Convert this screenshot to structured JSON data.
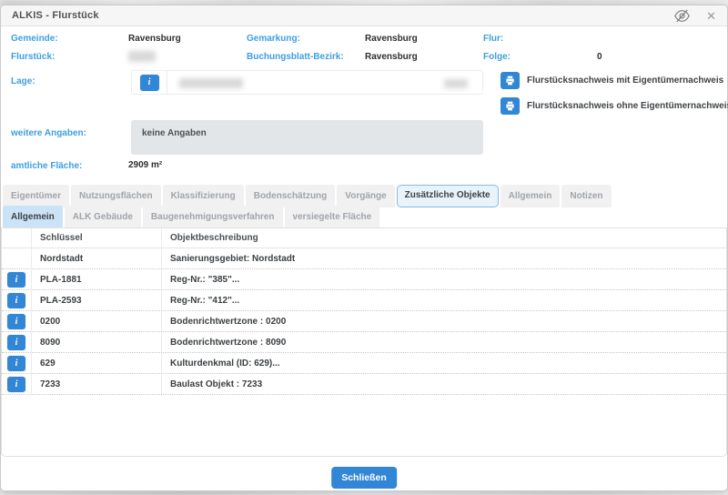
{
  "window": {
    "title": "ALKIS - Flurstück"
  },
  "icons": {
    "hide": "eye-slash",
    "close": "✕",
    "info": "i",
    "printer": "printer-glyph"
  },
  "colors": {
    "accent": "#3286d6",
    "label_blue": "#3d9fe0",
    "tab_active_main_bg": "#e9f3fb",
    "tab_active_sub_bg": "#cbe3f6",
    "tab_inactive_bg": "#f1f1f2",
    "gray_box_bg": "#e2e6e9"
  },
  "fields": {
    "gemeinde": {
      "label": "Gemeinde:",
      "value": "Ravensburg"
    },
    "gemarkung": {
      "label": "Gemarkung:",
      "value": "Ravensburg"
    },
    "flur": {
      "label": "Flur:",
      "value": ""
    },
    "flurstueck": {
      "label": "Flurstück:",
      "value": ""
    },
    "buchungsblatt_bezirk": {
      "label": "Buchungsblatt-Bezirk:",
      "value": "Ravensburg"
    },
    "folge": {
      "label": "Folge:",
      "value": "0"
    },
    "lage": {
      "label": "Lage:",
      "value": ""
    },
    "weitere_angaben": {
      "label": "weitere Angaben:",
      "value": "keine Angaben"
    },
    "amtliche_flaeche": {
      "label": "amtliche Fläche:",
      "value": "2909 m²"
    }
  },
  "print_actions": [
    {
      "label": "Flurstücksnachweis mit Eigentümernachweis"
    },
    {
      "label": "Flurstücksnachweis ohne Eigentümernachweis"
    }
  ],
  "tabs": {
    "main": [
      {
        "label": "Eigentümer",
        "active": false
      },
      {
        "label": "Nutzungsflächen",
        "active": false
      },
      {
        "label": "Klassifizierung",
        "active": false
      },
      {
        "label": "Bodenschätzung",
        "active": false
      },
      {
        "label": "Vorgänge",
        "active": false
      },
      {
        "label": "Zusätzliche Objekte",
        "active": true
      },
      {
        "label": "Allgemein",
        "active": false
      },
      {
        "label": "Notizen",
        "active": false
      }
    ],
    "sub": [
      {
        "label": "Allgemein",
        "active": true
      },
      {
        "label": "ALK Gebäude",
        "active": false
      },
      {
        "label": "Baugenehmigungsverfahren",
        "active": false
      },
      {
        "label": "versiegelte Fläche",
        "active": false
      }
    ]
  },
  "table": {
    "columns": [
      "Schlüssel",
      "Objektbeschreibung"
    ],
    "rows": [
      {
        "has_info": false,
        "key": "Nordstadt",
        "description": "Sanierungsgebiet: Nordstadt"
      },
      {
        "has_info": true,
        "key": "PLA-1881",
        "description": "Reg-Nr.: \"385\"..."
      },
      {
        "has_info": true,
        "key": "PLA-2593",
        "description": "Reg-Nr.: \"412\"..."
      },
      {
        "has_info": true,
        "key": "0200",
        "description": "Bodenrichtwertzone : 0200"
      },
      {
        "has_info": true,
        "key": "8090",
        "description": "Bodenrichtwertzone : 8090"
      },
      {
        "has_info": true,
        "key": "629",
        "description": "Kulturdenkmal (ID: 629)..."
      },
      {
        "has_info": true,
        "key": "7233",
        "description": "Baulast Objekt : 7233"
      }
    ]
  },
  "footer": {
    "close_label": "Schließen"
  }
}
